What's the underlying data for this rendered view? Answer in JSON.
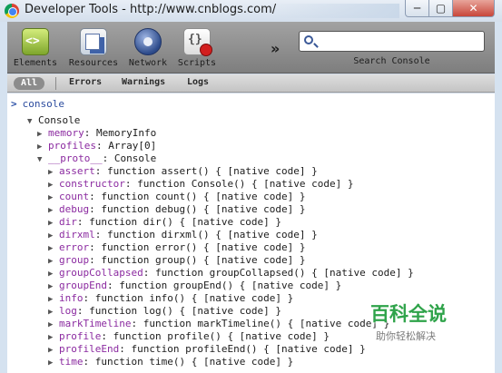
{
  "window": {
    "title": "Developer Tools - http://www.cnblogs.com/",
    "minimize": "─",
    "maximize": "▢",
    "close": "✕"
  },
  "toolbar": {
    "tools": [
      {
        "label": "Elements",
        "icon": "elements-icon"
      },
      {
        "label": "Resources",
        "icon": "resources-icon"
      },
      {
        "label": "Network",
        "icon": "network-icon"
      },
      {
        "label": "Scripts",
        "icon": "scripts-icon"
      }
    ],
    "overflow": "»",
    "search_label": "Search Console",
    "search_value": ""
  },
  "filters": {
    "all": "All",
    "errors": "Errors",
    "warnings": "Warnings",
    "logs": "Logs"
  },
  "console": {
    "prompt": ">",
    "command": "console",
    "root": "Console",
    "rows": [
      {
        "key": "memory",
        "value": "MemoryInfo"
      },
      {
        "key": "profiles",
        "value": "Array[0]"
      },
      {
        "key": "__proto__",
        "value": "Console"
      },
      {
        "key": "assert",
        "value": "function assert() { [native code] }"
      },
      {
        "key": "constructor",
        "value": "function Console() { [native code] }"
      },
      {
        "key": "count",
        "value": "function count() { [native code] }"
      },
      {
        "key": "debug",
        "value": "function debug() { [native code] }"
      },
      {
        "key": "dir",
        "value": "function dir() { [native code] }"
      },
      {
        "key": "dirxml",
        "value": "function dirxml() { [native code] }"
      },
      {
        "key": "error",
        "value": "function error() { [native code] }"
      },
      {
        "key": "group",
        "value": "function group() { [native code] }"
      },
      {
        "key": "groupCollapsed",
        "value": "function groupCollapsed() { [native code] }"
      },
      {
        "key": "groupEnd",
        "value": "function groupEnd() { [native code] }"
      },
      {
        "key": "info",
        "value": "function info() { [native code] }"
      },
      {
        "key": "log",
        "value": "function log() { [native code] }"
      },
      {
        "key": "markTimeline",
        "value": "function markTimeline() { [native code] }"
      },
      {
        "key": "profile",
        "value": "function profile() { [native code] }"
      },
      {
        "key": "profileEnd",
        "value": "function profileEnd() { [native code] }"
      },
      {
        "key": "time",
        "value": "function time() { [native code] }"
      }
    ]
  },
  "watermark": {
    "title": "百科全说",
    "subtitle": "助你轻松解决"
  }
}
